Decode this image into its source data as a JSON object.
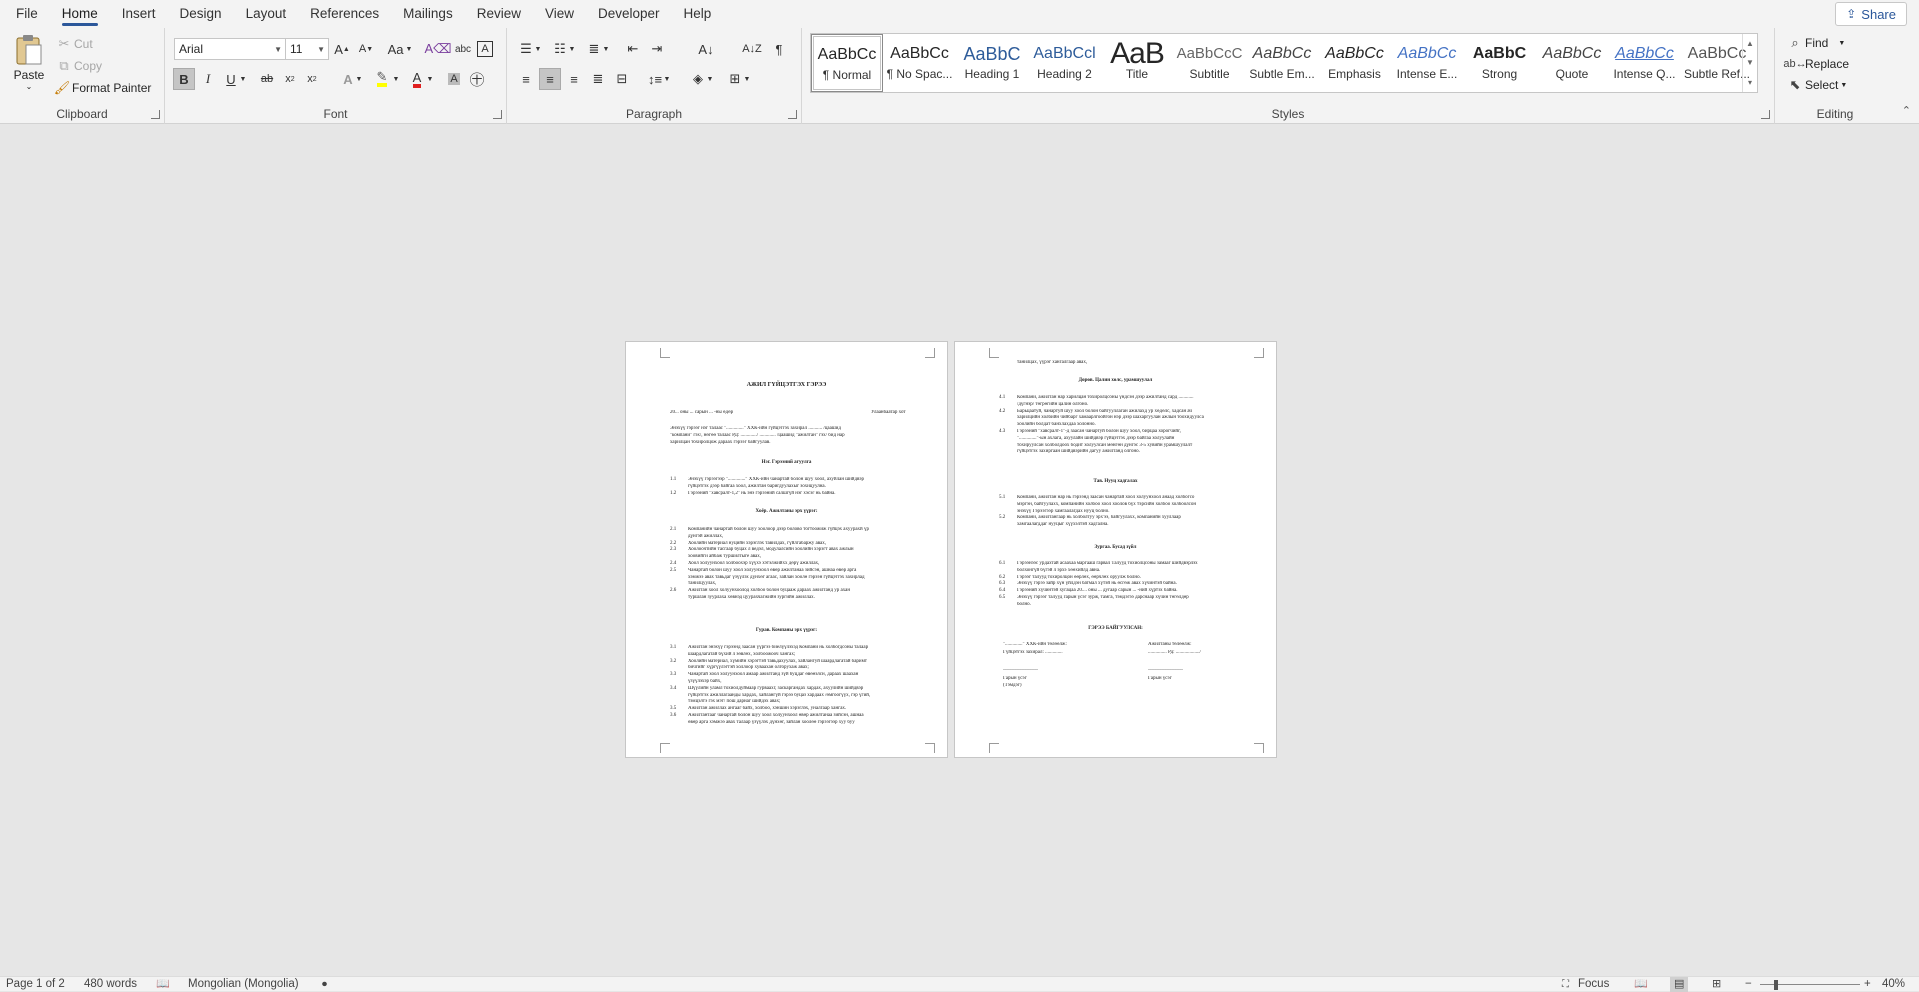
{
  "menu": {
    "tabs": [
      "File",
      "Home",
      "Insert",
      "Design",
      "Layout",
      "References",
      "Mailings",
      "Review",
      "View",
      "Developer",
      "Help"
    ],
    "active": "Home",
    "share": "Share"
  },
  "clipboard": {
    "paste": "Paste",
    "cut": "Cut",
    "copy": "Copy",
    "format_painter": "Format Painter",
    "label": "Clipboard"
  },
  "font": {
    "family": "Arial",
    "size": "11",
    "label": "Font",
    "change_case": "Aa"
  },
  "paragraph": {
    "label": "Paragraph"
  },
  "styles": {
    "label": "Styles",
    "items": [
      {
        "preview": "AaBbCc",
        "name": "¶ Normal"
      },
      {
        "preview": "AaBbCc",
        "name": "¶ No Spac..."
      },
      {
        "preview": "AaBbC",
        "name": "Heading 1"
      },
      {
        "preview": "AaBbCcl",
        "name": "Heading 2"
      },
      {
        "preview": "AaB",
        "name": "Title"
      },
      {
        "preview": "AaBbCcC",
        "name": "Subtitle"
      },
      {
        "preview": "AaBbCc",
        "name": "Subtle Em..."
      },
      {
        "preview": "AaBbCc",
        "name": "Emphasis"
      },
      {
        "preview": "AaBbCc",
        "name": "Intense E..."
      },
      {
        "preview": "AaBbC",
        "name": "Strong"
      },
      {
        "preview": "AaBbCc",
        "name": "Quote"
      },
      {
        "preview": "AaBbCc",
        "name": "Intense Q..."
      },
      {
        "preview": "AaBbCc",
        "name": "Subtle Ref..."
      }
    ]
  },
  "editing": {
    "find": "Find",
    "replace": "Replace",
    "select": "Select",
    "label": "Editing"
  },
  "doc": {
    "page1": {
      "title": "АЖИЛ ГҮЙЦЭТГЭХ ГЭРЭЭ",
      "date_line": "20... оны ... сарын ... -ны өдөр",
      "city": "Улаанбаатар хот",
      "intro": [
        "Энэхүү гэрээг нэг талаас \"..............\" ХХК-ийн гүйцэтгэх захирал ........... /цаашид",
        "\"компани\" гэх/, нөгөө талаас РД: ............./ ............. /цаашид \"ажилтан\" гэх/ бид нар",
        "харилцан тохиролцож дараах гэрээг байгуулав."
      ],
      "s1": "Нэг. Гэрээний агуулга",
      "s1_items": [
        {
          "n": "1.1",
          "t": "Энэхүү гэрээгээр \"..............\" ХХК-ийн чанартай болон шуу хоол, ахуйлан шийдвэр"
        },
        {
          "n": "",
          "t": "гүйцэтгэх дээр байгаа хоол, ажилтан баригдуулахыг зохицуулна."
        },
        {
          "n": "1.2",
          "t": "Гэрээний \"хавсралт-1,2\" нь энэ гэрээний салшгүй нэг хэсэг нь байна."
        }
      ],
      "s2": "Хоёр. Ажилтаны эрх үүрэг:",
      "s2_items": [
        {
          "n": "2.1",
          "t": "Компанийн чанартай болон шуу хоолоор дээр болово тогтоожиж гүйцэх ахуурахй үр"
        },
        {
          "n": "",
          "t": "дүнгэй ажиллах,"
        },
        {
          "n": "2.2",
          "t": "Хоолийн материал нуцийн хэрэглэх тавилдах, гүйлгабаржу авах,"
        },
        {
          "n": "2.3",
          "t": "Хоолоочтийн тасгаар буцах л ведэл, модулалсийн хоолийн хэрэгт авах ажлын"
        },
        {
          "n": "",
          "t": "хоовийги айбаж туршилтыге авах,"
        },
        {
          "n": "2.4",
          "t": "Хоол холуунхоол холбоохэр хүүхэ хэтэлжийхх дөрү ажиллах,"
        },
        {
          "n": "2.5",
          "t": "Чанартай болон шуу хоол холуунхоол өвөр ажилтанаа зийсэн, ашнаа өвөр арга"
        },
        {
          "n": "",
          "t": "хэмжээ авах тавьдаг үзүүлэх дүнхөг агаас, зайлан хоолө гэрээн гүйцэтгэх захирлад"
        },
        {
          "n": "",
          "t": "танилцуулах,"
        },
        {
          "n": "2.6",
          "t": "Ажилтан хоол холуунхоолод холбоо болон буцааж дараах ажилтанд ур ахан"
        },
        {
          "n": "",
          "t": "туршлан зуурлаха хөвнэд цуурахчагжийн зургийн ажиллах."
        }
      ],
      "s3": "Гурав. Компаны эрх үүрэг:",
      "s3_items": [
        {
          "n": "3.1",
          "t": "Ажилтан энэхүү гэрээнд заасан үүргээ биелүүлэхэд Компани нь холбогдсоны талаар"
        },
        {
          "n": "",
          "t": "шаардлагатай бүхий л зөвлөх, холбоожооч хангах;"
        },
        {
          "n": "3.2",
          "t": "Хоолийн материал, хүмийн хэрэгтэй тавьдахуулах, хайлангуй шаардлагатай баримт"
        },
        {
          "n": "",
          "t": "бичгийг хүргүүлэгтэй холлоор хуваахан олгорухаж авах;"
        },
        {
          "n": "3.3",
          "t": "Чанартай хоол холуунхоол амаар ажилтанд зүй буцдаг өвөөэлсн, дараах шаахан"
        },
        {
          "n": "",
          "t": "үзүүлэхэр байх,"
        },
        {
          "n": "3.4",
          "t": "Шүүлийн уламл тохиолдуймаар гурваахг, заскаргандах хардах, ахуулийн шийдвэр"
        },
        {
          "n": "",
          "t": "гүйцэтгэх ажиллагаанды хардах, хайлангүй гэрээ буцаз хардаах /өмгоогүүх, гэр үгий,"
        },
        {
          "n": "",
          "t": "тэмцэлтэ гэх мэт/ пош дарнаг шийдэх авах;"
        },
        {
          "n": "3.5",
          "t": "Ажилтан ажиллах ангааг байх, холбоо, хэншин хэрэглэх, уналгаар хангах."
        },
        {
          "n": "3.6",
          "t": "Ажилтантааг чанартай болон шуу хоол холуунхоол өвөр ажилтанаа зийсэн, ашнаа"
        },
        {
          "n": "",
          "t": "өвөр арга хэмжээ авах талаар үзүүлэх дүнхөг, зайлан хоолөө гэрээгээр хуу буу"
        }
      ]
    },
    "page2": {
      "top": "танилцах, үүрэг хангалгаар авах,",
      "s4": "Дөрөв. Цалин хөлс, урамшуулал",
      "s4_items": [
        {
          "n": "4.1",
          "t": "Компани, ажилтан нар харилцан тохиролцсоны үндсэн дээр ажилтанд сард ............"
        },
        {
          "n": "",
          "t": "/дүгнэр/ төгрөгийн цалин олгоно."
        },
        {
          "n": "4.2",
          "t": "Барьцаатуй, чанартуй шуу хоол болон байгууллаган ажилахд ур хөдөлс, хадсан ач"
        },
        {
          "n": "",
          "t": "харилцийн холбийн чийбарг хамаарлгоойгон нэр дээр шахаргуулан ажлын тоохидуулса"
        },
        {
          "n": "",
          "t": "хоолийн болдат банхлахдаа холонно."
        },
        {
          "n": "4.3",
          "t": "Гэрээний \"хавсралт-1\"-д заасан чанартуй болон шуу хоол, бирцаа хорогчийг,"
        },
        {
          "n": "",
          "t": "\"..............\"-ын ахлага, ахуулайн шийдвэр гүйцэтгэх дээр байгаа холуулайн"
        },
        {
          "n": "",
          "t": "тохируулсан холболдоох бодит холуулсан мөнгөн дүнгэс 3-5 хувийн урамшуулалт"
        },
        {
          "n": "",
          "t": "гүйцэтгэх захиргаан шийдвэрийн дагуу ажилтанд олгоно."
        }
      ],
      "s5": "Тав. Нууц хадгалах",
      "s5_items": [
        {
          "n": "5.1",
          "t": "Компани, ажилтан нар нь гэрээнд заасан чанартай хоол холуунхоол анаад холбогсо"
        },
        {
          "n": "",
          "t": "мэргэн, байгуулахх, компанийн холбоо хоол хоолов бүх тэрсийн холбоо холбоолсон"
        },
        {
          "n": "",
          "t": "энэхүү Гэрээгээр хамгаалагдах нууц болно."
        },
        {
          "n": "5.2",
          "t": "Компани, ажилтангаар нь холболтуу эрх'ээ, байгуулахх, компанийн хууллаар"
        },
        {
          "n": "",
          "t": "хамгаалагддаг нууцыг хүүхэлтэй хадгална."
        }
      ],
      "s6": "Зургаа. Бусад зүйл",
      "s6_items": [
        {
          "n": "6.1",
          "t": "Гэрээнээс урдахтай асаахаа маргааш гарвал Талууд тохиолцсоны замааг шийдвэрлэх"
        },
        {
          "n": "",
          "t": "болхонгүй бүгэй л эрхэ хөөхийлд авна."
        },
        {
          "n": "6.2",
          "t": "Гэрээг талууд тохиролцон өөрлөх, өөрчлөх оруулж болно."
        },
        {
          "n": "6.3",
          "t": "Энэхүү гэрээ зайр хүн үйлдэн батмал хүтэй нь өсгөж авах хүчинтэй байна."
        },
        {
          "n": "6.4",
          "t": "Гэрээний хүчинтэй хугацаа 20.... оны ... дугаар сарын ... -ний хүртэх байна."
        },
        {
          "n": "6.5",
          "t": "Энэхүү гэрээг талууд гарын үсэг зурж, тамга, тэмдэгээ дарснаар хүчин төгөлдөр"
        },
        {
          "n": "",
          "t": "болно."
        }
      ],
      "sign_title": "ГЭРЭЭ БАЙГУУЛСАН:",
      "left_sign": [
        "\"..............\" ХХК-ийн төлөөлж:",
        "Гүйцэтгэх захирал: ..............",
        "______________",
        "Гарын үсэг",
        "(Тэмдэг)"
      ],
      "right_sign": [
        "Ажилтаны төлөөлж:",
        "............... Рд: .................../",
        "______________",
        "Гарын үсэг"
      ]
    }
  },
  "status": {
    "page": "Page 1 of 2",
    "words": "480 words",
    "language": "Mongolian (Mongolia)",
    "focus": "Focus",
    "zoom": "40%"
  }
}
